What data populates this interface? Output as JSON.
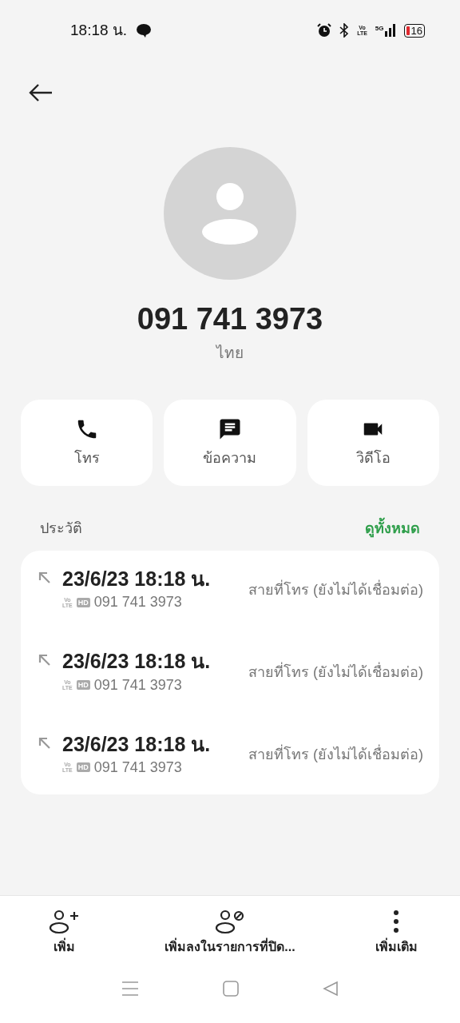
{
  "status_bar": {
    "time": "18:18 น.",
    "volte_top": "Vo",
    "volte_bottom": "LTE",
    "network": "5G",
    "battery": "16"
  },
  "contact": {
    "number": "091 741 3973",
    "label": "ไทย"
  },
  "actions": [
    {
      "kind": "call",
      "label": "โทร"
    },
    {
      "kind": "message",
      "label": "ข้อความ"
    },
    {
      "kind": "video",
      "label": "วิดีโอ"
    }
  ],
  "history": {
    "title": "ประวัติ",
    "see_all": "ดูทั้งหมด",
    "entries": [
      {
        "datetime": "23/6/23 18:18 น.",
        "volte_top": "Vo",
        "volte_bottom": "LTE",
        "hd": "HD",
        "number": "091 741 3973",
        "status": "สายที่โทร (ยังไม่ได้เชื่อมต่อ)"
      },
      {
        "datetime": "23/6/23 18:18 น.",
        "volte_top": "Vo",
        "volte_bottom": "LTE",
        "hd": "HD",
        "number": "091 741 3973",
        "status": "สายที่โทร (ยังไม่ได้เชื่อมต่อ)"
      },
      {
        "datetime": "23/6/23 18:18 น.",
        "volte_top": "Vo",
        "volte_bottom": "LTE",
        "hd": "HD",
        "number": "091 741 3973",
        "status": "สายที่โทร (ยังไม่ได้เชื่อมต่อ)"
      }
    ]
  },
  "bottom_bar": [
    {
      "kind": "add",
      "label": "เพิ่ม"
    },
    {
      "kind": "block",
      "label": "เพิ่มลงในรายการที่ปิด..."
    },
    {
      "kind": "more",
      "label": "เพิ่มเติม"
    }
  ]
}
